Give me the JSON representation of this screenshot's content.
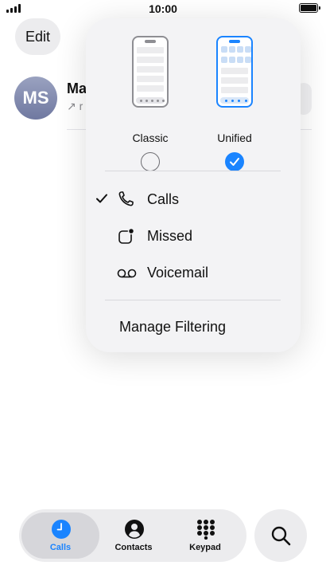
{
  "status_bar": {
    "time": "10:00"
  },
  "header": {
    "edit_label": "Edit"
  },
  "recents": [
    {
      "initials": "MS",
      "name_visible": "Ma",
      "subtitle_visible": "↗ r"
    }
  ],
  "filter_menu": {
    "layouts": [
      {
        "label": "Classic",
        "selected": false
      },
      {
        "label": "Unified",
        "selected": true
      }
    ],
    "items": [
      {
        "label": "Calls",
        "icon": "phone-icon",
        "checked": true
      },
      {
        "label": "Missed",
        "icon": "missed-badge-icon",
        "checked": false
      },
      {
        "label": "Voicemail",
        "icon": "voicemail-icon",
        "checked": false
      }
    ],
    "manage_label": "Manage Filtering"
  },
  "tab_bar": {
    "tabs": [
      {
        "label": "Calls",
        "icon": "clock-icon",
        "active": true
      },
      {
        "label": "Contacts",
        "icon": "person-circle-icon",
        "active": false
      },
      {
        "label": "Keypad",
        "icon": "keypad-icon",
        "active": false
      }
    ],
    "search_icon": "search-icon"
  },
  "colors": {
    "accent": "#1a84ff",
    "menu_background": "#f3f3f5",
    "avatar": "#7f88ad"
  }
}
